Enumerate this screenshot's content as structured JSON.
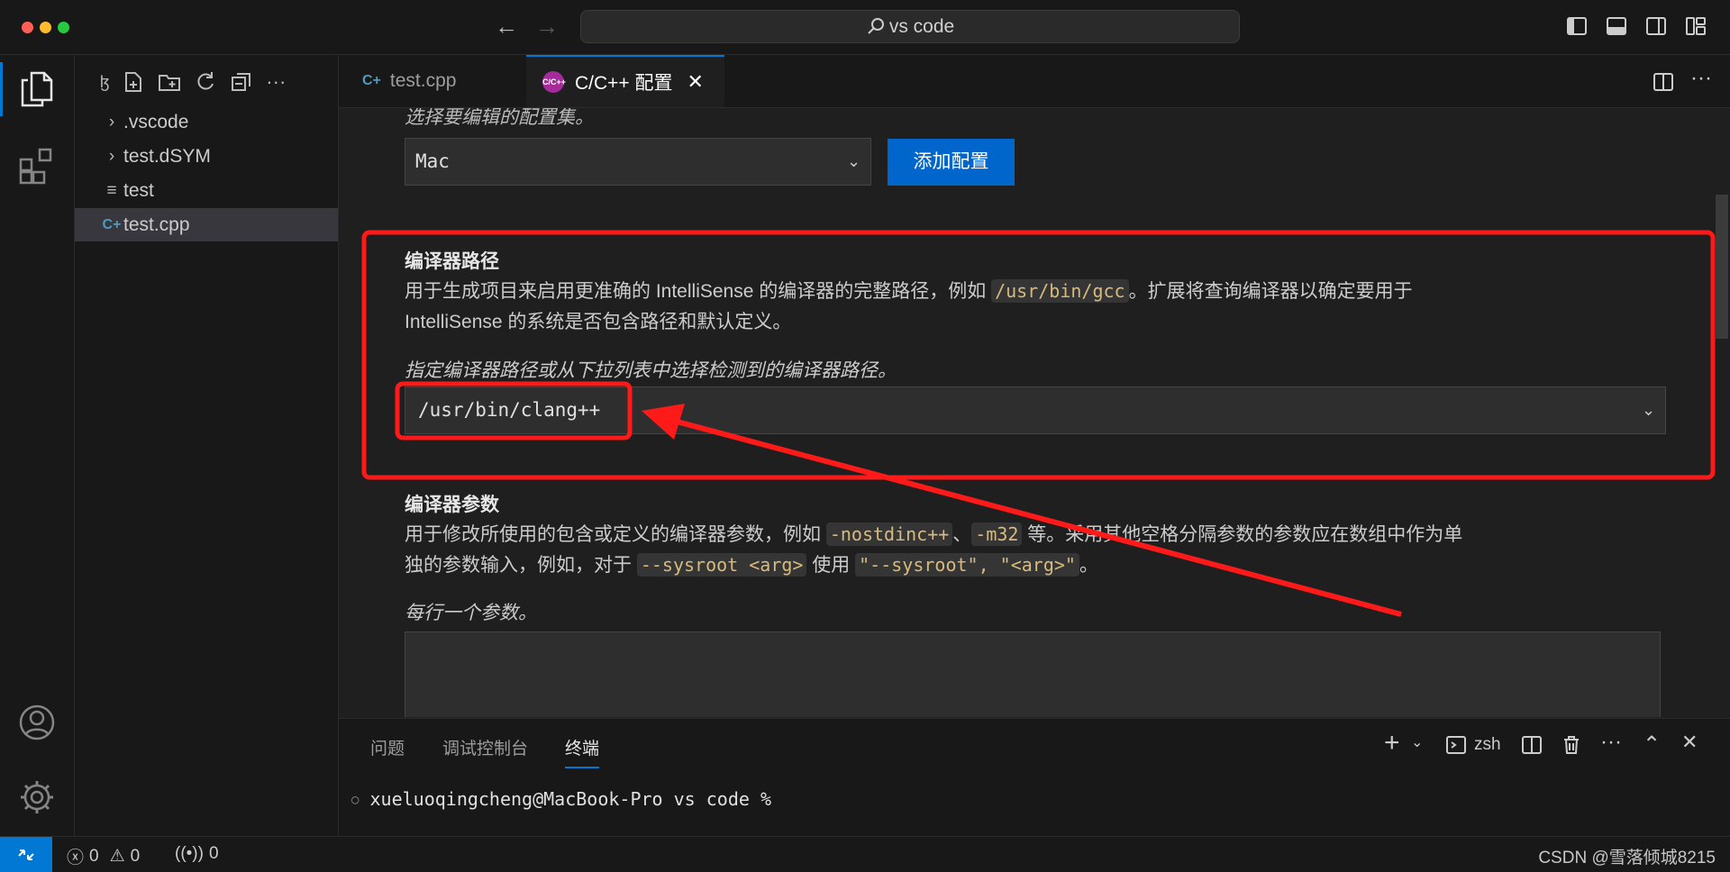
{
  "titlebar": {
    "search_text": "vs code"
  },
  "sidebar": {
    "items": [
      {
        "label": ".vscode",
        "kind": "folder"
      },
      {
        "label": "test.dSYM",
        "kind": "folder"
      },
      {
        "label": "test",
        "kind": "file"
      },
      {
        "label": "test.cpp",
        "kind": "cpp",
        "selected": true
      }
    ]
  },
  "tabs": [
    {
      "label": "test.cpp"
    },
    {
      "label": "C/C++ 配置",
      "active": true
    }
  ],
  "editor": {
    "config_desc": "选择要编辑的配置集。",
    "config_value": "Mac",
    "add_config_label": "添加配置",
    "compiler_path": {
      "title": "编译器路径",
      "desc_pre": "用于生成项目来启用更准确的 IntelliSense 的编译器的完整路径，例如 ",
      "desc_code": "/usr/bin/gcc",
      "desc_post": "。扩展将查询编译器以确定要用于",
      "desc_line2": "IntelliSense 的系统是否包含路径和默认定义。",
      "hint": "指定编译器路径或从下拉列表中选择检测到的编译器路径。",
      "value": "/usr/bin/clang++"
    },
    "compiler_args": {
      "title": "编译器参数",
      "desc_pre": "用于修改所使用的包含或定义的编译器参数，例如 ",
      "code1": "-nostdinc++",
      "sep": "、",
      "code2": "-m32",
      "desc_mid": " 等。采用其他空格分隔参数的参数应在数组中作为单",
      "line2_pre": "独的参数输入，例如，对于 ",
      "code3": "--sysroot <arg>",
      "line2_mid": " 使用 ",
      "code4": "\"--sysroot\", \"<arg>\"",
      "line2_post": "。",
      "hint": "每行一个参数。"
    }
  },
  "panel": {
    "tabs": [
      "问题",
      "调试控制台",
      "终端"
    ],
    "active_tab": "终端",
    "shell_label": "zsh",
    "terminal_prompt": "xueluoqingcheng@MacBook-Pro vs code %"
  },
  "statusbar": {
    "errors": "0",
    "warnings": "0",
    "ports": "0",
    "watermark": "CSDN @雪落倾城8215"
  },
  "colors": {
    "accent": "#0078d4",
    "annotation": "#ff1a1a",
    "button": "#0066cc"
  }
}
